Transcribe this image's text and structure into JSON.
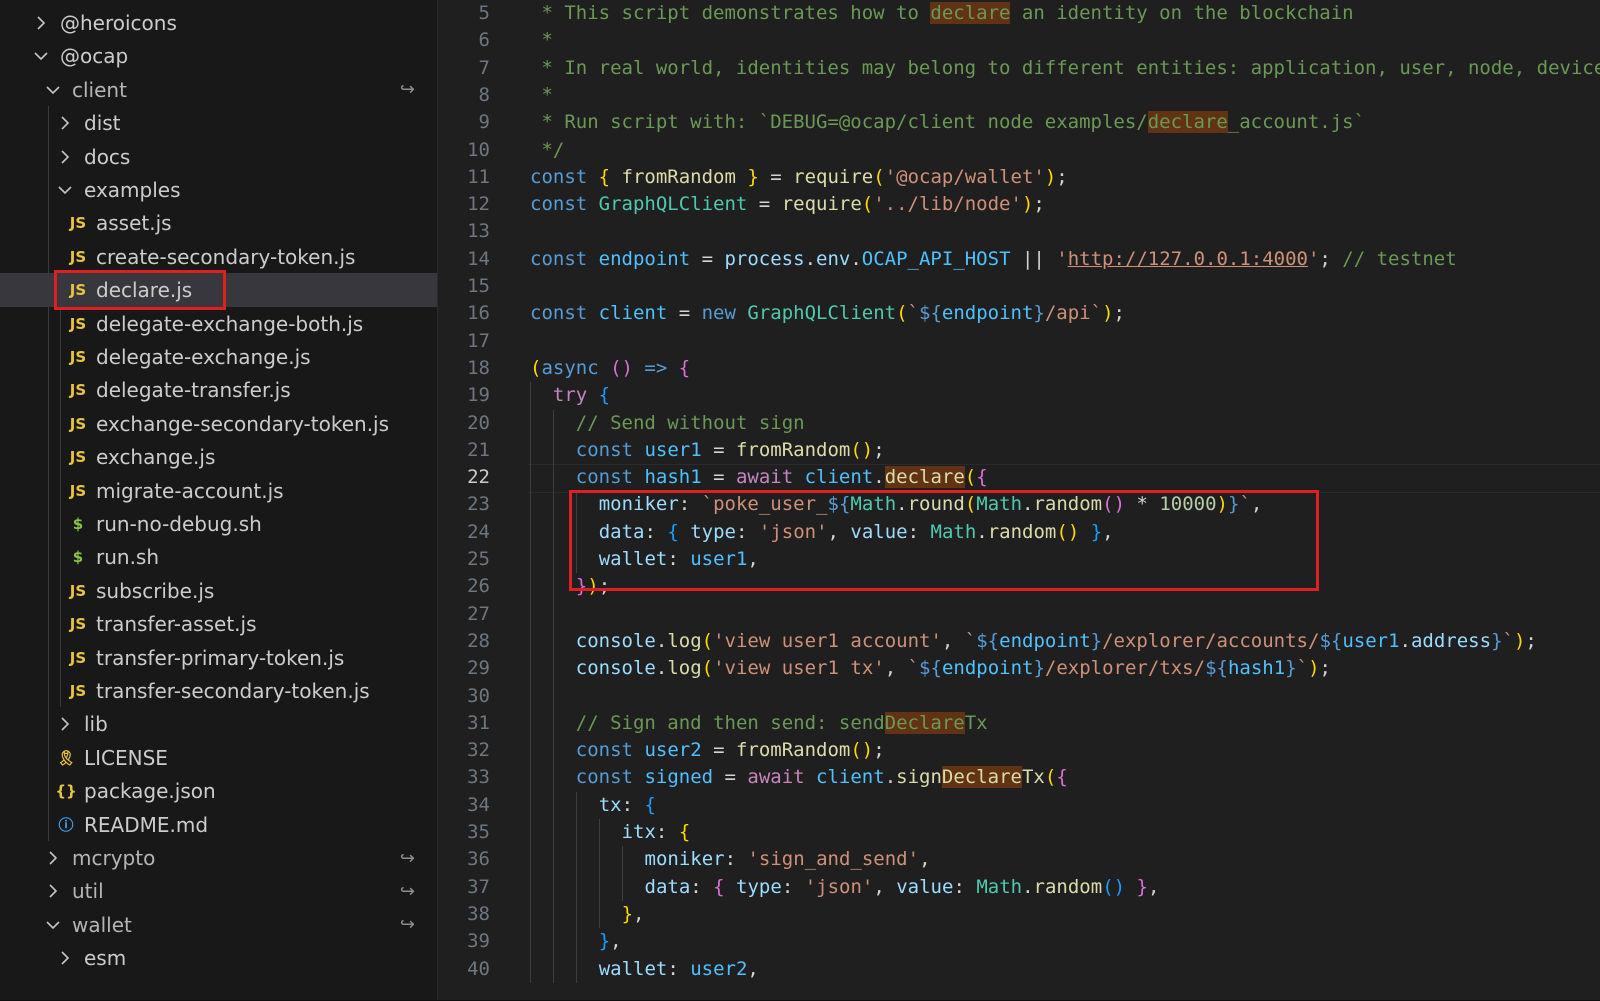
{
  "explorer": {
    "items": [
      {
        "label": "@heroicons",
        "kind": "folder",
        "open": false,
        "depth": 0
      },
      {
        "label": "@ocap",
        "kind": "folder",
        "open": true,
        "depth": 0
      },
      {
        "label": "client",
        "kind": "folder",
        "open": true,
        "depth": 1,
        "repo": true
      },
      {
        "label": "dist",
        "kind": "folder",
        "open": false,
        "depth": 2
      },
      {
        "label": "docs",
        "kind": "folder",
        "open": false,
        "depth": 2
      },
      {
        "label": "examples",
        "kind": "folder",
        "open": true,
        "depth": 2
      },
      {
        "label": "asset.js",
        "kind": "js",
        "depth": 3
      },
      {
        "label": "create-secondary-token.js",
        "kind": "js",
        "depth": 3
      },
      {
        "label": "declare.js",
        "kind": "js",
        "depth": 3,
        "selected": true
      },
      {
        "label": "delegate-exchange-both.js",
        "kind": "js",
        "depth": 3
      },
      {
        "label": "delegate-exchange.js",
        "kind": "js",
        "depth": 3
      },
      {
        "label": "delegate-transfer.js",
        "kind": "js",
        "depth": 3
      },
      {
        "label": "exchange-secondary-token.js",
        "kind": "js",
        "depth": 3
      },
      {
        "label": "exchange.js",
        "kind": "js",
        "depth": 3
      },
      {
        "label": "migrate-account.js",
        "kind": "js",
        "depth": 3
      },
      {
        "label": "run-no-debug.sh",
        "kind": "sh",
        "depth": 3
      },
      {
        "label": "run.sh",
        "kind": "sh",
        "depth": 3
      },
      {
        "label": "subscribe.js",
        "kind": "js",
        "depth": 3
      },
      {
        "label": "transfer-asset.js",
        "kind": "js",
        "depth": 3
      },
      {
        "label": "transfer-primary-token.js",
        "kind": "js",
        "depth": 3
      },
      {
        "label": "transfer-secondary-token.js",
        "kind": "js",
        "depth": 3
      },
      {
        "label": "lib",
        "kind": "folder",
        "open": false,
        "depth": 2
      },
      {
        "label": "LICENSE",
        "kind": "license",
        "depth": 2
      },
      {
        "label": "package.json",
        "kind": "json",
        "depth": 2
      },
      {
        "label": "README.md",
        "kind": "info",
        "depth": 2
      },
      {
        "label": "mcrypto",
        "kind": "folder",
        "open": false,
        "depth": 1,
        "repo": true
      },
      {
        "label": "util",
        "kind": "folder",
        "open": false,
        "depth": 1,
        "repo": true
      },
      {
        "label": "wallet",
        "kind": "folder",
        "open": true,
        "depth": 1,
        "repo": true
      },
      {
        "label": "esm",
        "kind": "folder",
        "open": false,
        "depth": 2
      }
    ]
  },
  "icons": {
    "chevron_right": "chevron-right-icon",
    "chevron_down": "chevron-down-icon",
    "js_file": "js-file-icon",
    "shell_file": "shell-file-icon",
    "license_file": "license-file-icon",
    "json_file": "json-file-icon",
    "info_file": "info-file-icon",
    "repo_link": "repository-link-icon"
  },
  "editor": {
    "active_line": 22,
    "lines": [
      {
        "n": 5,
        "indent": 0,
        "t": [
          [
            "c-cm",
            " * This script demonstrates how to "
          ],
          [
            "c-cm hl",
            "declare"
          ],
          [
            "c-cm",
            " an identity on the blockchain"
          ]
        ]
      },
      {
        "n": 6,
        "indent": 0,
        "t": [
          [
            "c-cm",
            " *"
          ]
        ]
      },
      {
        "n": 7,
        "indent": 0,
        "t": [
          [
            "c-cm",
            " * In real world, identities may belong to different entities: application, user, node, device"
          ]
        ]
      },
      {
        "n": 8,
        "indent": 0,
        "t": [
          [
            "c-cm",
            " *"
          ]
        ]
      },
      {
        "n": 9,
        "indent": 0,
        "t": [
          [
            "c-cm",
            " * Run script with: `DEBUG=@ocap/client node examples/"
          ],
          [
            "c-cm hl",
            "declare"
          ],
          [
            "c-cm",
            "_account.js`"
          ]
        ]
      },
      {
        "n": 10,
        "indent": 0,
        "t": [
          [
            "c-cm",
            " */"
          ]
        ]
      },
      {
        "n": 11,
        "indent": 0,
        "t": [
          [
            "c-kw",
            "const "
          ],
          [
            "c-p1",
            "{ "
          ],
          [
            "c-fn",
            "fromRandom"
          ],
          [
            "",
            " "
          ],
          [
            "c-p1",
            "}"
          ],
          [
            "",
            " = "
          ],
          [
            "c-fn",
            "require"
          ],
          [
            "c-p1",
            "("
          ],
          [
            "c-str",
            "'@ocap/wallet'"
          ],
          [
            "c-p1",
            ")"
          ],
          [
            "",
            ";"
          ]
        ]
      },
      {
        "n": 12,
        "indent": 0,
        "t": [
          [
            "c-kw",
            "const "
          ],
          [
            "c-cls",
            "GraphQLClient"
          ],
          [
            "",
            " = "
          ],
          [
            "c-fn",
            "require"
          ],
          [
            "c-p1",
            "("
          ],
          [
            "c-str",
            "'../lib/node'"
          ],
          [
            "c-p1",
            ")"
          ],
          [
            "",
            ";"
          ]
        ]
      },
      {
        "n": 13,
        "indent": 0,
        "t": []
      },
      {
        "n": 14,
        "indent": 0,
        "t": [
          [
            "c-kw",
            "const "
          ],
          [
            "c-var",
            "endpoint"
          ],
          [
            "",
            " = "
          ],
          [
            "c-id",
            "process"
          ],
          [
            "",
            "."
          ],
          [
            "c-id",
            "env"
          ],
          [
            "",
            "."
          ],
          [
            "c-var",
            "OCAP_API_HOST"
          ],
          [
            "",
            " || "
          ],
          [
            "c-str",
            "'"
          ],
          [
            "c-str url",
            "http://127.0.0.1:4000"
          ],
          [
            "c-str",
            "'"
          ],
          [
            "",
            "; "
          ],
          [
            "c-cm",
            "// testnet"
          ]
        ]
      },
      {
        "n": 15,
        "indent": 0,
        "t": []
      },
      {
        "n": 16,
        "indent": 0,
        "t": [
          [
            "c-kw",
            "const "
          ],
          [
            "c-var",
            "client"
          ],
          [
            "",
            " = "
          ],
          [
            "c-kw",
            "new "
          ],
          [
            "c-cls",
            "GraphQLClient"
          ],
          [
            "c-p1",
            "("
          ],
          [
            "c-str",
            "`"
          ],
          [
            "c-tpl",
            "${"
          ],
          [
            "c-var",
            "endpoint"
          ],
          [
            "c-tpl",
            "}"
          ],
          [
            "c-str",
            "/api`"
          ],
          [
            "c-p1",
            ")"
          ],
          [
            "",
            ";"
          ]
        ]
      },
      {
        "n": 17,
        "indent": 0,
        "t": []
      },
      {
        "n": 18,
        "indent": 0,
        "t": [
          [
            "c-p1",
            "("
          ],
          [
            "c-kw",
            "async "
          ],
          [
            "c-p2",
            "() "
          ],
          [
            "c-kw",
            "=> "
          ],
          [
            "c-p2",
            "{"
          ]
        ]
      },
      {
        "n": 19,
        "indent": 1,
        "t": [
          [
            "c-ctrl",
            "try "
          ],
          [
            "c-p3",
            "{"
          ]
        ]
      },
      {
        "n": 20,
        "indent": 2,
        "t": [
          [
            "c-cm",
            "// Send without sign"
          ]
        ]
      },
      {
        "n": 21,
        "indent": 2,
        "t": [
          [
            "c-kw",
            "const "
          ],
          [
            "c-var",
            "user1"
          ],
          [
            "",
            " = "
          ],
          [
            "c-fn",
            "fromRandom"
          ],
          [
            "c-p1",
            "()"
          ],
          [
            "",
            ";"
          ]
        ]
      },
      {
        "n": 22,
        "indent": 2,
        "t": [
          [
            "c-kw",
            "const "
          ],
          [
            "c-var",
            "hash1"
          ],
          [
            "",
            " = "
          ],
          [
            "c-ctrl",
            "await "
          ],
          [
            "c-var",
            "client"
          ],
          [
            "",
            "."
          ],
          [
            "c-fn hl",
            "declare"
          ],
          [
            "c-p1",
            "("
          ],
          [
            "c-p2",
            "{"
          ]
        ]
      },
      {
        "n": 23,
        "indent": 3,
        "t": [
          [
            "c-id",
            "moniker"
          ],
          [
            "",
            ": "
          ],
          [
            "c-str",
            "`poke_user_"
          ],
          [
            "c-tpl",
            "${"
          ],
          [
            "c-cls",
            "Math"
          ],
          [
            "",
            "."
          ],
          [
            "c-fn",
            "round"
          ],
          [
            "c-p1",
            "("
          ],
          [
            "c-cls",
            "Math"
          ],
          [
            "",
            "."
          ],
          [
            "c-fn",
            "random"
          ],
          [
            "c-p2",
            "()"
          ],
          [
            "",
            " * "
          ],
          [
            "c-num",
            "10000"
          ],
          [
            "c-p1",
            ")"
          ],
          [
            "c-tpl",
            "}"
          ],
          [
            "c-str",
            "`"
          ],
          [
            "",
            ","
          ]
        ]
      },
      {
        "n": 24,
        "indent": 3,
        "t": [
          [
            "c-id",
            "data"
          ],
          [
            "",
            ": "
          ],
          [
            "c-p3",
            "{ "
          ],
          [
            "c-id",
            "type"
          ],
          [
            "",
            ": "
          ],
          [
            "c-str",
            "'json'"
          ],
          [
            "",
            ", "
          ],
          [
            "c-id",
            "value"
          ],
          [
            "",
            ": "
          ],
          [
            "c-cls",
            "Math"
          ],
          [
            "",
            "."
          ],
          [
            "c-fn",
            "random"
          ],
          [
            "c-p1",
            "()"
          ],
          [
            "",
            " "
          ],
          [
            "c-p3",
            "}"
          ],
          [
            "",
            ","
          ]
        ]
      },
      {
        "n": 25,
        "indent": 3,
        "t": [
          [
            "c-id",
            "wallet"
          ],
          [
            "",
            ": "
          ],
          [
            "c-var",
            "user1"
          ],
          [
            "",
            ","
          ]
        ]
      },
      {
        "n": 26,
        "indent": 2,
        "t": [
          [
            "c-p2",
            "}"
          ],
          [
            "c-p1",
            ")"
          ],
          [
            "",
            ";"
          ]
        ]
      },
      {
        "n": 27,
        "indent": 0,
        "t": []
      },
      {
        "n": 28,
        "indent": 2,
        "t": [
          [
            "c-id",
            "console"
          ],
          [
            "",
            "."
          ],
          [
            "c-fn",
            "log"
          ],
          [
            "c-p1",
            "("
          ],
          [
            "c-str",
            "'view user1 account'"
          ],
          [
            "",
            ", "
          ],
          [
            "c-str",
            "`"
          ],
          [
            "c-tpl",
            "${"
          ],
          [
            "c-var",
            "endpoint"
          ],
          [
            "c-tpl",
            "}"
          ],
          [
            "c-str",
            "/explorer/accounts/"
          ],
          [
            "c-tpl",
            "${"
          ],
          [
            "c-var",
            "user1"
          ],
          [
            "",
            "."
          ],
          [
            "c-id",
            "address"
          ],
          [
            "c-tpl",
            "}"
          ],
          [
            "c-str",
            "`"
          ],
          [
            "c-p1",
            ")"
          ],
          [
            "",
            ";"
          ]
        ]
      },
      {
        "n": 29,
        "indent": 2,
        "t": [
          [
            "c-id",
            "console"
          ],
          [
            "",
            "."
          ],
          [
            "c-fn",
            "log"
          ],
          [
            "c-p1",
            "("
          ],
          [
            "c-str",
            "'view user1 tx'"
          ],
          [
            "",
            ", "
          ],
          [
            "c-str",
            "`"
          ],
          [
            "c-tpl",
            "${"
          ],
          [
            "c-var",
            "endpoint"
          ],
          [
            "c-tpl",
            "}"
          ],
          [
            "c-str",
            "/explorer/txs/"
          ],
          [
            "c-tpl",
            "${"
          ],
          [
            "c-var",
            "hash1"
          ],
          [
            "c-tpl",
            "}"
          ],
          [
            "c-str",
            "`"
          ],
          [
            "c-p1",
            ")"
          ],
          [
            "",
            ";"
          ]
        ]
      },
      {
        "n": 30,
        "indent": 0,
        "t": []
      },
      {
        "n": 31,
        "indent": 2,
        "t": [
          [
            "c-cm",
            "// Sign and then send: send"
          ],
          [
            "c-cm hl",
            "Declare"
          ],
          [
            "c-cm",
            "Tx"
          ]
        ]
      },
      {
        "n": 32,
        "indent": 2,
        "t": [
          [
            "c-kw",
            "const "
          ],
          [
            "c-var",
            "user2"
          ],
          [
            "",
            " = "
          ],
          [
            "c-fn",
            "fromRandom"
          ],
          [
            "c-p1",
            "()"
          ],
          [
            "",
            ";"
          ]
        ]
      },
      {
        "n": 33,
        "indent": 2,
        "t": [
          [
            "c-kw",
            "const "
          ],
          [
            "c-var",
            "signed"
          ],
          [
            "",
            " = "
          ],
          [
            "c-ctrl",
            "await "
          ],
          [
            "c-var",
            "client"
          ],
          [
            "",
            "."
          ],
          [
            "c-fn",
            "sign"
          ],
          [
            "c-fn hl",
            "Declare"
          ],
          [
            "c-fn",
            "Tx"
          ],
          [
            "c-p1",
            "("
          ],
          [
            "c-p2",
            "{"
          ]
        ]
      },
      {
        "n": 34,
        "indent": 3,
        "t": [
          [
            "c-id",
            "tx"
          ],
          [
            "",
            ": "
          ],
          [
            "c-p3",
            "{"
          ]
        ]
      },
      {
        "n": 35,
        "indent": 4,
        "t": [
          [
            "c-id",
            "itx"
          ],
          [
            "",
            ": "
          ],
          [
            "c-p1",
            "{"
          ]
        ]
      },
      {
        "n": 36,
        "indent": 5,
        "t": [
          [
            "c-id",
            "moniker"
          ],
          [
            "",
            ": "
          ],
          [
            "c-str",
            "'sign_and_send'"
          ],
          [
            "",
            ","
          ]
        ]
      },
      {
        "n": 37,
        "indent": 5,
        "t": [
          [
            "c-id",
            "data"
          ],
          [
            "",
            ": "
          ],
          [
            "c-p2",
            "{ "
          ],
          [
            "c-id",
            "type"
          ],
          [
            "",
            ": "
          ],
          [
            "c-str",
            "'json'"
          ],
          [
            "",
            ", "
          ],
          [
            "c-id",
            "value"
          ],
          [
            "",
            ": "
          ],
          [
            "c-cls",
            "Math"
          ],
          [
            "",
            "."
          ],
          [
            "c-fn",
            "random"
          ],
          [
            "c-p3",
            "()"
          ],
          [
            "",
            " "
          ],
          [
            "c-p2",
            "}"
          ],
          [
            "",
            ","
          ]
        ]
      },
      {
        "n": 38,
        "indent": 4,
        "t": [
          [
            "c-p1",
            "}"
          ],
          [
            "",
            ","
          ]
        ]
      },
      {
        "n": 39,
        "indent": 3,
        "t": [
          [
            "c-p3",
            "}"
          ],
          [
            "",
            ","
          ]
        ]
      },
      {
        "n": 40,
        "indent": 3,
        "t": [
          [
            "c-id",
            "wallet"
          ],
          [
            "",
            ": "
          ],
          [
            "c-var",
            "user2"
          ],
          [
            "",
            ","
          ]
        ]
      }
    ]
  }
}
